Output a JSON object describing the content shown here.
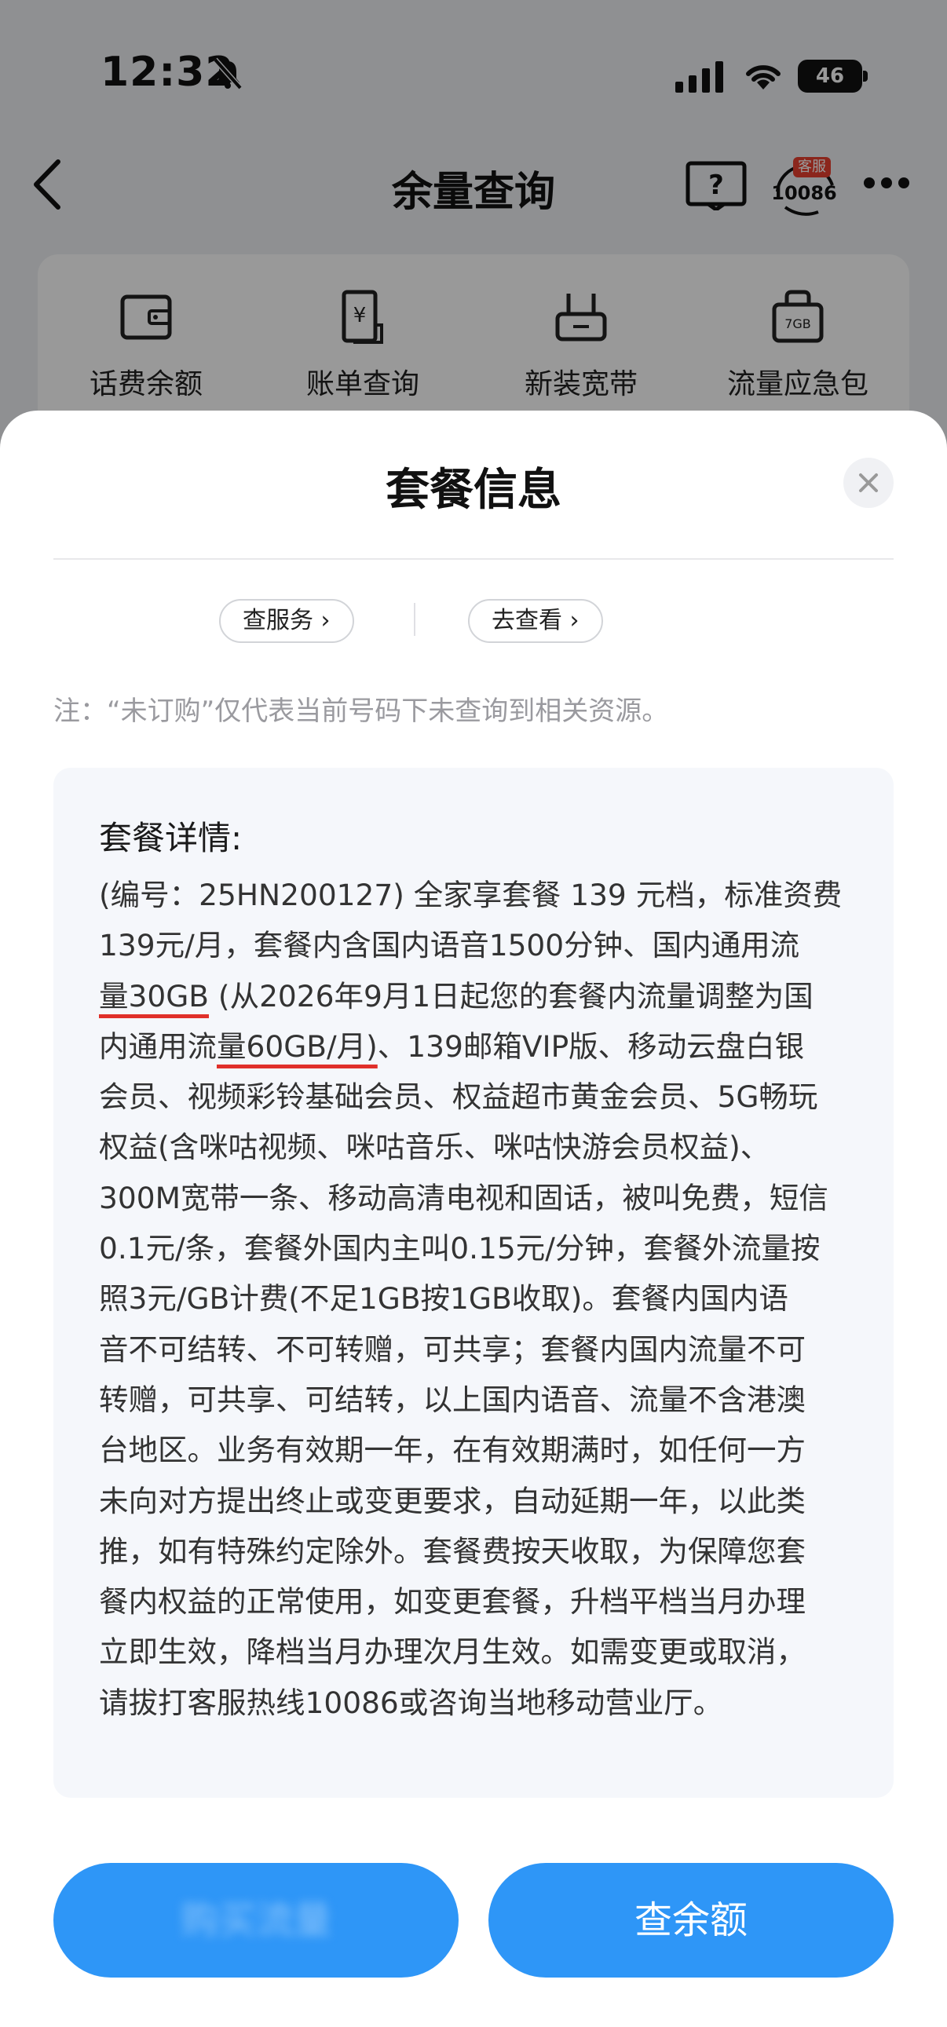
{
  "status_bar": {
    "time": "12:32",
    "battery": "46"
  },
  "nav": {
    "title": "余量查询",
    "cs_badge": "客服",
    "cs_number": "10086"
  },
  "quick_actions": [
    {
      "label": "话费余额",
      "icon": "wallet-icon"
    },
    {
      "label": "账单查询",
      "icon": "bill-icon"
    },
    {
      "label": "新装宽带",
      "icon": "router-icon"
    },
    {
      "label": "流量应急包",
      "icon": "data-pack-icon",
      "icon_text": "7GB"
    }
  ],
  "sheet": {
    "title": "套餐信息",
    "links": {
      "service": "查服务 ›",
      "view": "去查看 ›"
    },
    "note": "注：“未订购”仅代表当前号码下未查询到相关资源。",
    "detail_heading": "套餐详情:",
    "detail_lines": [
      "(编号：25HN200127) 全家享套餐 139 元档，标准资费",
      "139元/月，套餐内含国内语音1500分钟、国内通用流",
      "量30GB",
      " (从2026年9月1日起您的套餐内流量调整为国",
      "内通用流",
      "量60GB/月)",
      "、139邮箱VIP版、移动云盘白银",
      "会员、视频彩铃基础会员、权益超市黄金会员、5G畅玩",
      "权益(含咪咕视频、咪咕音乐、咪咕快游会员权益)、",
      "300M宽带一条、移动高清电视和固话，被叫免费，短信",
      "0.1元/条，套餐外国内主叫0.15元/分钟，套餐外流量按",
      "照3元/GB计费(不足1GB按1GB收取)。套餐内国内语",
      "音不可结转、不可转赠，可共享；套餐内国内流量不可",
      "转赠，可共享、可结转，以上国内语音、流量不含港澳",
      "台地区。业务有效期一年，在有效期满时，如任何一方",
      "未向对方提出终止或变更要求，自动延期一年，以此类",
      "推，如有特殊约定除外。套餐费按天收取，为保障您套",
      "餐内权益的正常使用，如变更套餐，升档平档当月办理",
      "立即生效，降档当月办理次月生效。如需变更或取消，",
      "请拔打客服热线10086或咨询当地移动营业厅。"
    ],
    "buttons": {
      "left": "购买流量",
      "right": "查余额"
    }
  },
  "colors": {
    "accent": "#2e96f7",
    "underline": "#e0302a",
    "badge": "#e8402f"
  }
}
